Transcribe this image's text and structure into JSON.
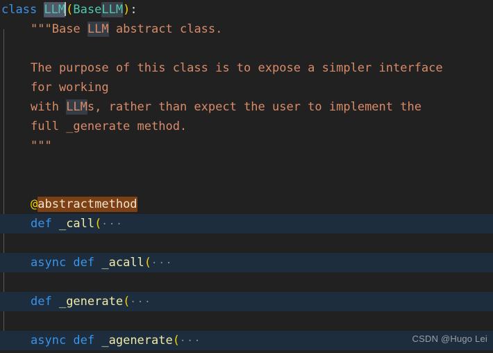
{
  "editor": {
    "background": "#212121",
    "selected_row_background": "#1d2d3e",
    "indent_guide_color": "#5a5a5a",
    "fold_marker": "···"
  },
  "colors": {
    "keyword": "#3b93e8",
    "class_name": "#4ec9b0",
    "paren": "#f5d000",
    "string": "#d98b6a",
    "function": "#f0eaa8",
    "decorator_at": "#f5d000",
    "decorator_highlight_bg": "#7d3f14",
    "occurrence_highlight_bg": "#3c424c",
    "cursor_highlight_bg": "#51596a",
    "watermark": "#9aa0a6"
  },
  "code": {
    "line1": {
      "keyword": "class",
      "space": " ",
      "class_name": "LLM",
      "open_paren": "(",
      "base_prefix": "Base",
      "base_suffix": "LLM",
      "close_paren": ")",
      "colon": ":"
    },
    "line2": {
      "quote_open": "\"\"\"",
      "text_before": "Base ",
      "highlight": "LLM",
      "text_after": " abstract class."
    },
    "line4": "The purpose of this class is to expose a simpler interface",
    "line5": "for working",
    "line6": {
      "text_before": "with ",
      "highlight": "LLM",
      "text_after": "s, rather than expect the user to implement the"
    },
    "line7": "full _generate method.",
    "line8": "\"\"\"",
    "decorator": {
      "at": "@",
      "name": "abstractmethod"
    },
    "method_call": {
      "keyword": "def",
      "name": " _call",
      "paren": "(",
      "fold": "···"
    },
    "method_acall": {
      "async": "async",
      "keyword": " def",
      "name": " _acall",
      "paren": "(",
      "fold": "···"
    },
    "method_generate": {
      "keyword": "def",
      "name": " _generate",
      "paren": "(",
      "fold": "···"
    },
    "method_agenerate": {
      "async": "async",
      "keyword": " def",
      "name": " _agenerate",
      "paren": "(",
      "fold": "···"
    }
  },
  "watermark": {
    "text": "CSDN @Hugo Lei"
  }
}
